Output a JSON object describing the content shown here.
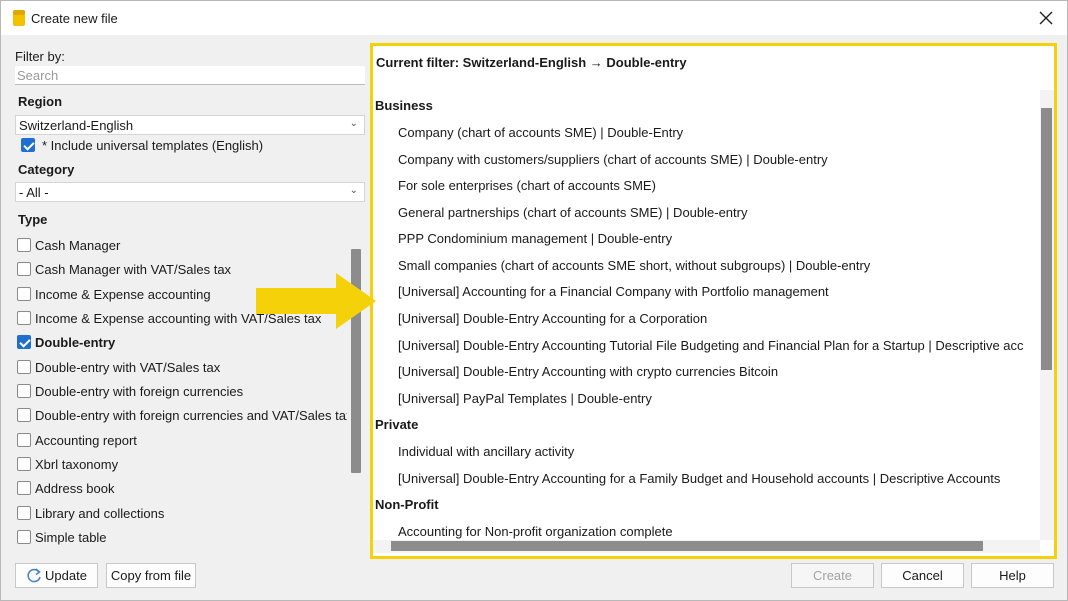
{
  "window": {
    "title": "Create new file",
    "close_icon": "close-icon"
  },
  "left": {
    "filter_label": "Filter by:",
    "search_placeholder": "Search",
    "region_label": "Region",
    "region_value": "Switzerland-English",
    "include_universal": {
      "label": "* Include universal templates (English)",
      "checked": true
    },
    "category_label": "Category",
    "category_value": "- All -",
    "type_label": "Type",
    "types": [
      {
        "label": "Cash Manager",
        "checked": false
      },
      {
        "label": "Cash Manager with VAT/Sales tax",
        "checked": false
      },
      {
        "label": "Income & Expense accounting",
        "checked": false
      },
      {
        "label": "Income & Expense accounting with VAT/Sales tax",
        "checked": false
      },
      {
        "label": "Double-entry",
        "checked": true
      },
      {
        "label": "Double-entry with VAT/Sales tax",
        "checked": false
      },
      {
        "label": "Double-entry with foreign currencies",
        "checked": false
      },
      {
        "label": "Double-entry with foreign currencies and VAT/Sales tax",
        "checked": false
      },
      {
        "label": "Accounting report",
        "checked": false
      },
      {
        "label": "Xbrl taxonomy",
        "checked": false
      },
      {
        "label": "Address book",
        "checked": false
      },
      {
        "label": "Library and collections",
        "checked": false
      },
      {
        "label": "Simple table",
        "checked": false
      }
    ]
  },
  "right": {
    "current_filter": "Current filter: Switzerland-English → Double-entry",
    "groups": [
      {
        "name": "Business",
        "items": [
          "Company (chart of accounts SME) | Double-Entry",
          "Company with customers/suppliers (chart of accounts SME) | Double-entry",
          "For sole enterprises (chart of accounts SME)",
          "General partnerships (chart of accounts SME) | Double-entry",
          "PPP Condominium management | Double-entry",
          "Small companies (chart of accounts SME short, without subgroups) | Double-entry",
          "[Universal] Accounting for a Financial Company with Portfolio management",
          "[Universal] Double-Entry Accounting for a Corporation",
          "[Universal] Double-Entry Accounting Tutorial File Budgeting and Financial Plan for a Startup | Descriptive acc",
          "[Universal] Double-Entry Accounting with crypto currencies Bitcoin",
          "[Universal] PayPal Templates | Double-entry"
        ]
      },
      {
        "name": "Private",
        "items": [
          "Individual with ancillary activity",
          "[Universal] Double-Entry Accounting for a Family Budget and Household accounts | Descriptive Accounts"
        ]
      },
      {
        "name": "Non-Profit",
        "items": [
          "Accounting for Non-profit organization complete"
        ]
      }
    ]
  },
  "buttons": {
    "update": "Update",
    "copy_from_file": "Copy from file",
    "create": "Create",
    "cancel": "Cancel",
    "help": "Help"
  },
  "colors": {
    "highlight_border": "#f5d10a",
    "arrow": "#f5d10a",
    "checkbox_checked": "#1f6fd1"
  },
  "icons": {
    "app": "banana-app-icon",
    "update": "refresh-icon",
    "combo": "chevron-down-icon",
    "pointer": "right-arrow-icon"
  }
}
